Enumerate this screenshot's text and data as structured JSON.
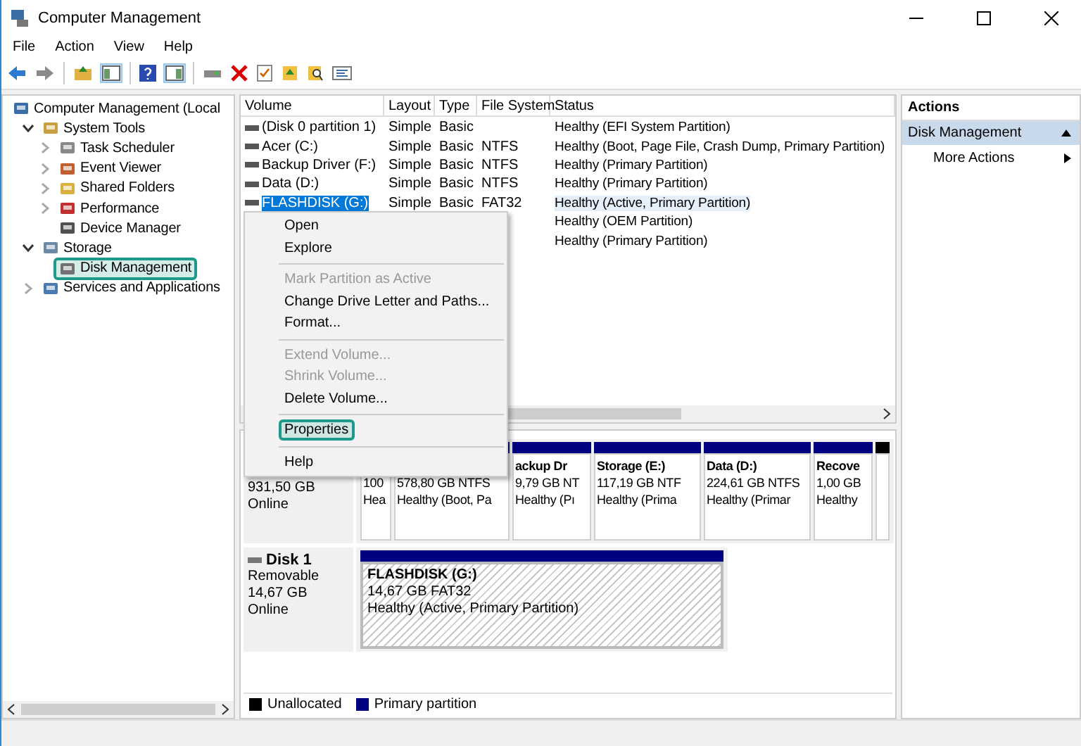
{
  "window": {
    "title": "Computer Management"
  },
  "menu_bar": [
    "File",
    "Action",
    "View",
    "Help"
  ],
  "tree": [
    {
      "label": "Computer Management (Local",
      "selected": false,
      "children": [
        {
          "label": "System Tools",
          "expanded": true,
          "selected": false,
          "children": [
            {
              "label": "Task Scheduler",
              "expanded": false,
              "selected": false
            },
            {
              "label": "Event Viewer",
              "expanded": false,
              "selected": false
            },
            {
              "label": "Shared Folders",
              "expanded": false,
              "selected": false
            },
            {
              "label": "Performance",
              "expanded": false,
              "selected": false
            },
            {
              "label": "Device Manager",
              "selected": false
            }
          ]
        },
        {
          "label": "Storage",
          "expanded": true,
          "selected": false,
          "children": [
            {
              "label": "Disk Management",
              "selected": true
            }
          ]
        },
        {
          "label": "Services and Applications",
          "expanded": false,
          "selected": false
        }
      ]
    }
  ],
  "volumes": {
    "columns": [
      "Volume",
      "Layout",
      "Type",
      "File System",
      "Status"
    ],
    "rows": [
      {
        "volume": "(Disk 0 partition 1)",
        "layout": "Simple",
        "type": "Basic",
        "status": "Healthy (EFI System Partition)",
        "selected": false
      },
      {
        "volume": "Acer (C:)",
        "layout": "Simple",
        "type": "Basic",
        "file_system": "NTFS",
        "status": "Healthy (Boot, Page File, Crash Dump, Primary Partition)",
        "selected": false
      },
      {
        "volume": "Backup Driver (F:)",
        "layout": "Simple",
        "type": "Basic",
        "file_system": "NTFS",
        "status": "Healthy (Primary Partition)",
        "selected": false
      },
      {
        "volume": "Data (D:)",
        "layout": "Simple",
        "type": "Basic",
        "file_system": "NTFS",
        "status": "Healthy (Primary Partition)",
        "selected": false
      },
      {
        "volume": "FLASHDISK (G:)",
        "layout": "Simple",
        "type": "Basic",
        "file_system": "FAT32",
        "status": "Healthy (Active, Primary Partition)",
        "selected": true
      },
      {
        "status": "Healthy (OEM Partition)",
        "selected": false
      },
      {
        "status": "Healthy (Primary Partition)",
        "selected": false
      }
    ]
  },
  "context_menu": [
    {
      "kind": "item",
      "label": "Open",
      "disabled": false,
      "selected": false
    },
    {
      "kind": "item",
      "label": "Explore",
      "disabled": false,
      "selected": false
    },
    {
      "kind": "separator"
    },
    {
      "kind": "item",
      "label": "Mark Partition as Active",
      "disabled": true,
      "selected": false
    },
    {
      "kind": "item",
      "label": "Change Drive Letter and Paths...",
      "disabled": false,
      "selected": false
    },
    {
      "kind": "item",
      "label": "Format...",
      "disabled": false,
      "selected": false
    },
    {
      "kind": "separator"
    },
    {
      "kind": "item",
      "label": "Extend Volume...",
      "disabled": true,
      "selected": false
    },
    {
      "kind": "item",
      "label": "Shrink Volume...",
      "disabled": true,
      "selected": false
    },
    {
      "kind": "item",
      "label": "Delete Volume...",
      "disabled": false,
      "selected": false
    },
    {
      "kind": "separator"
    },
    {
      "kind": "item",
      "label": "Properties",
      "disabled": false,
      "selected": true
    },
    {
      "kind": "separator"
    },
    {
      "kind": "item",
      "label": "Help",
      "disabled": false,
      "selected": false
    }
  ],
  "disks": [
    {
      "lines": [
        "931,50 GB",
        "Online"
      ],
      "partitions": [
        {
          "kind": "primary",
          "lines": [
            "100",
            "Hea"
          ],
          "selected": false
        },
        {
          "kind": "primary",
          "lines": [
            "578,80 GB NTFS",
            "Healthy (Boot, Pa"
          ],
          "selected": false
        },
        {
          "kind": "primary",
          "label": "ackup Dr",
          "lines": [
            "9,79 GB NT",
            "Healthy (Pı"
          ],
          "selected": false
        },
        {
          "kind": "primary",
          "label": "Storage  (E:)",
          "lines": [
            "117,19 GB NTF",
            "Healthy (Prima"
          ],
          "selected": false
        },
        {
          "kind": "primary",
          "label": "Data  (D:)",
          "lines": [
            "224,61 GB NTFS",
            "Healthy (Primar"
          ],
          "selected": false
        },
        {
          "kind": "primary",
          "label": "Recove",
          "lines": [
            "1,00 GB",
            "Healthy"
          ],
          "selected": false
        },
        {
          "kind": "unallocated",
          "selected": false
        }
      ]
    },
    {
      "name": "Disk 1",
      "lines": [
        "Removable",
        "14,67 GB",
        "Online"
      ],
      "partitions": [
        {
          "kind": "primary",
          "label": "FLASHDISK  (G:)",
          "lines": [
            "14,67 GB FAT32",
            "Healthy (Active, Primary Partition)"
          ],
          "selected": true
        }
      ]
    }
  ],
  "legend": [
    {
      "label": "Unallocated",
      "color": "#000000"
    },
    {
      "label": "Primary partition",
      "color": "#000080"
    }
  ],
  "actions": {
    "title": "Actions",
    "section": "Disk Management",
    "items": [
      "More Actions"
    ]
  }
}
